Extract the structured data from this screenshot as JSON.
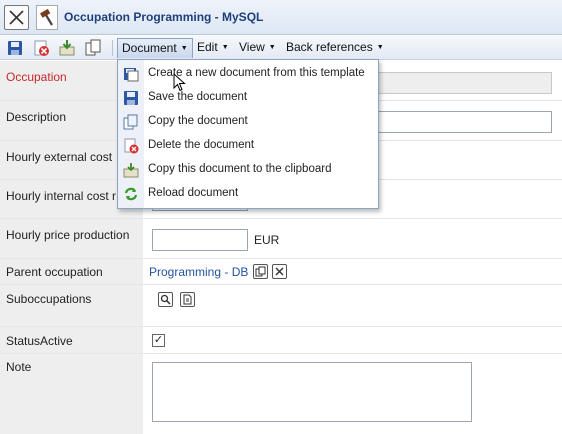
{
  "window": {
    "title": "Occupation Programming - MySQL"
  },
  "toolbar": {
    "icons": [
      "save-icon",
      "delete-icon",
      "copy-to-clipboard-icon",
      "copy-document-icon"
    ],
    "menus": [
      {
        "label": "Document"
      },
      {
        "label": "Edit"
      },
      {
        "label": "View"
      },
      {
        "label": "Back references"
      }
    ]
  },
  "dropdown": {
    "items": [
      {
        "label": "Create a new document from this template",
        "icon": "template-icon"
      },
      {
        "label": "Save the document",
        "icon": "save-icon"
      },
      {
        "label": "Copy the document",
        "icon": "copy-icon"
      },
      {
        "label": "Delete the document",
        "icon": "delete-icon"
      },
      {
        "label": "Copy this document to the clipboard",
        "icon": "clipboard-icon"
      },
      {
        "label": "Reload document",
        "icon": "reload-icon"
      }
    ]
  },
  "form": {
    "occupation": {
      "label": "Occupation",
      "value": ""
    },
    "description": {
      "label": "Description",
      "value": ""
    },
    "hourly_external_cost": {
      "label": "Hourly external cost",
      "value": ""
    },
    "hourly_internal_cost": {
      "label": "Hourly internal cost r",
      "value": ""
    },
    "hourly_price_production": {
      "label": "Hourly price production",
      "value": "",
      "unit": "EUR"
    },
    "parent_occupation": {
      "label": "Parent occupation",
      "value": "Programming - DB"
    },
    "suboccupations": {
      "label": "Suboccupations"
    },
    "status_active": {
      "label": "StatusActive",
      "checked": true,
      "check_glyph": "✓"
    },
    "note": {
      "label": "Note",
      "value": ""
    }
  },
  "colors": {
    "accent": "#1f3f7a",
    "link": "#2353a0",
    "required": "#c62828",
    "label_bg": "#eeeeee"
  }
}
